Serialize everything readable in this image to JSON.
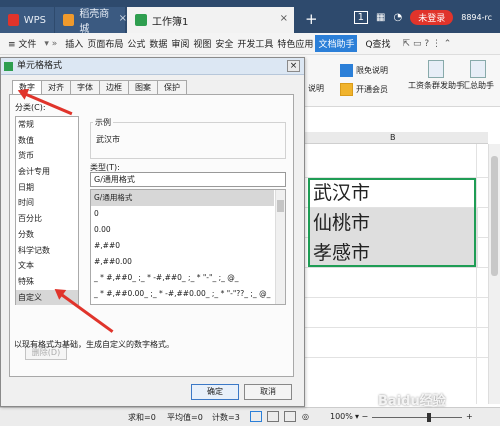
{
  "titlebar": {
    "tabs": [
      {
        "label": "WPS"
      },
      {
        "label": "稻壳商城"
      },
      {
        "label": "工作簿1"
      }
    ],
    "badge": "1",
    "login_button": "未登录",
    "user_id": "8894-rc"
  },
  "menubar": {
    "file": "≡ 文件",
    "items": [
      "插入",
      "页面布局",
      "公式",
      "数据",
      "审阅",
      "视图",
      "安全",
      "开发工具",
      "特色应用"
    ],
    "active": "文档助手",
    "search": "Q查找"
  },
  "ribbon": {
    "items": [
      {
        "label": "限免说明"
      },
      {
        "label": "开通会员"
      },
      {
        "label": "工资条群发助手"
      },
      {
        "label": "汇总助手"
      },
      {
        "label": "说明"
      }
    ]
  },
  "sheet": {
    "column": "B",
    "cells": [
      "武汉市",
      "仙桃市",
      "孝感市"
    ]
  },
  "dialog": {
    "title": "单元格格式",
    "close": "×",
    "tabs": [
      "数字",
      "对齐",
      "字体",
      "边框",
      "图案",
      "保护"
    ],
    "category_label": "分类(C):",
    "categories": [
      "常规",
      "数值",
      "货币",
      "会计专用",
      "日期",
      "时间",
      "百分比",
      "分数",
      "科学记数",
      "文本",
      "特殊",
      "自定义"
    ],
    "selected_category": "自定义",
    "sample_label": "示例",
    "sample_value": "武汉市",
    "type_label": "类型(T):",
    "type_value": "G/通用格式",
    "type_items": [
      "G/通用格式",
      "0",
      "0.00",
      "#,##0",
      "#,##0.00",
      "_ * #,##0_ ;_ * -#,##0_ ;_ * \"-\"_ ;_ @_",
      "_ * #,##0.00_ ;_ * -#,##0.00_ ;_ * \"-\"??_ ;_ @_"
    ],
    "delete_button": "删除(D)",
    "description": "以现有格式为基础，生成自定义的数字格式。",
    "ok_button": "确定",
    "cancel_button": "取消"
  },
  "statusbar": {
    "sum": "求和=0",
    "avg": "平均值=0",
    "count": "计数=3",
    "zoom": "100%"
  },
  "watermark": "Baidu经验",
  "colors": {
    "accent": "#2b7fd8",
    "arrow": "#e0342b",
    "selection": "#1f9d55",
    "titlebar": "#2e4a6d"
  }
}
